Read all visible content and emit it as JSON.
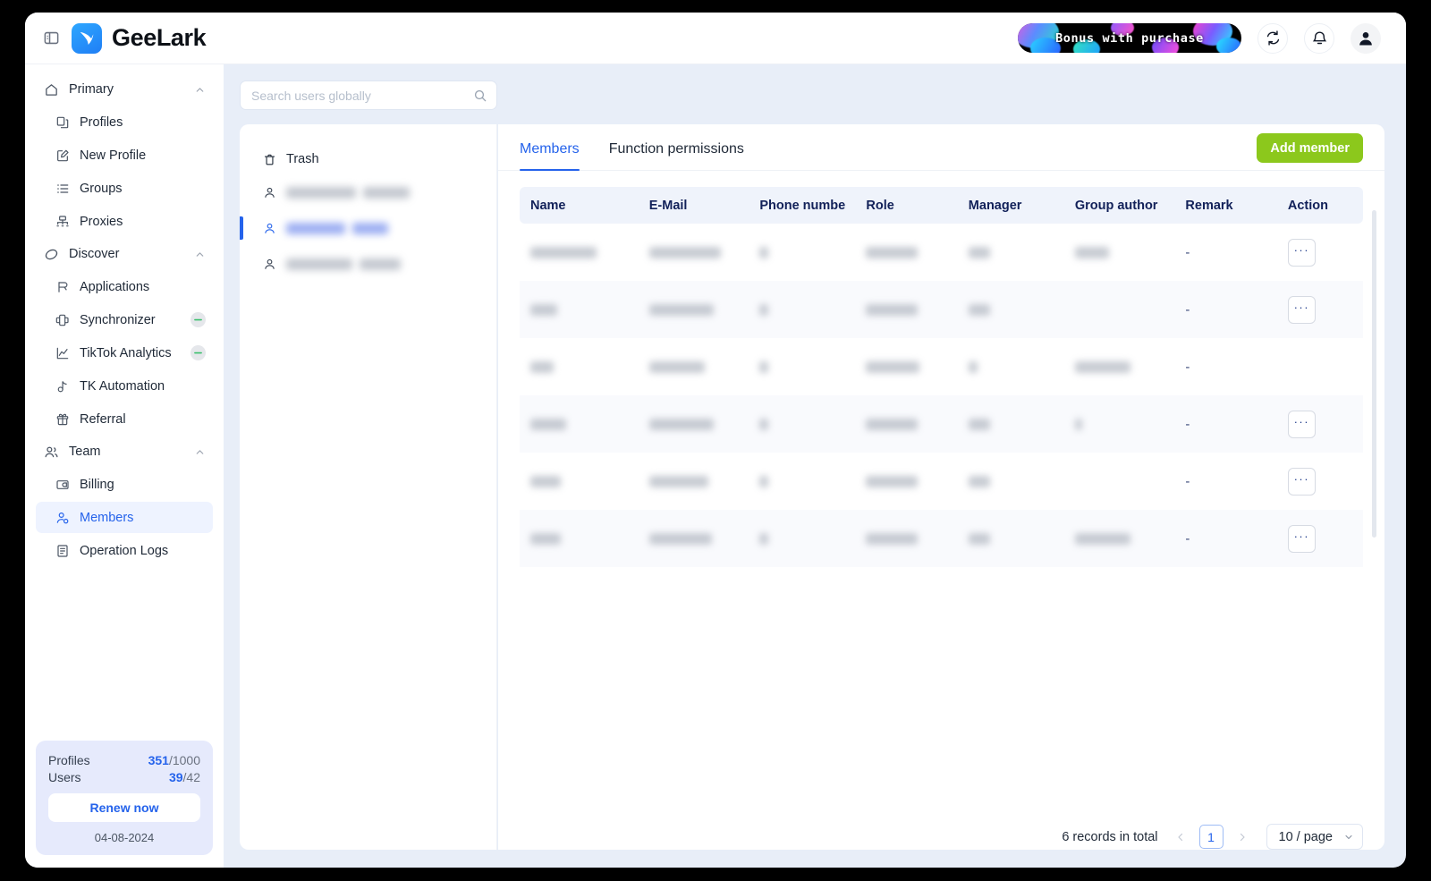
{
  "window": {
    "title": "GeeLark"
  },
  "topbar": {
    "panel_toggle_icon": "panel-left-icon",
    "brand_name": "GeeLark",
    "promo_text": "Bonus with purchase",
    "refresh_icon": "refresh-icon",
    "notification_icon": "bell-icon",
    "avatar_icon": "user-avatar-icon",
    "accent_green": "#8cc81c",
    "accent_blue": "#2563eb"
  },
  "sidebar": {
    "groups": [
      {
        "label": "Primary",
        "icon": "home-icon",
        "expanded": true,
        "items": [
          {
            "label": "Profiles",
            "icon": "profiles-icon"
          },
          {
            "label": "New Profile",
            "icon": "new-profile-icon"
          },
          {
            "label": "Groups",
            "icon": "groups-icon"
          },
          {
            "label": "Proxies",
            "icon": "proxies-icon"
          }
        ]
      },
      {
        "label": "Discover",
        "icon": "discover-icon",
        "expanded": true,
        "items": [
          {
            "label": "Applications",
            "icon": "applications-icon"
          },
          {
            "label": "Synchronizer",
            "icon": "synchronizer-icon",
            "badge": true
          },
          {
            "label": "TikTok Analytics",
            "icon": "analytics-icon",
            "badge": true
          },
          {
            "label": "TK Automation",
            "icon": "tiktok-note-icon"
          },
          {
            "label": "Referral",
            "icon": "gift-icon"
          }
        ]
      },
      {
        "label": "Team",
        "icon": "team-icon",
        "expanded": true,
        "items": [
          {
            "label": "Billing",
            "icon": "billing-icon"
          },
          {
            "label": "Members",
            "icon": "members-icon",
            "active": true
          },
          {
            "label": "Operation Logs",
            "icon": "logs-icon"
          }
        ]
      }
    ],
    "plan_card": {
      "profiles_label": "Profiles",
      "profiles_used": "351",
      "profiles_total": "/1000",
      "users_label": "Users",
      "users_used": "39",
      "users_total": "/42",
      "renew_label": "Renew now",
      "expiry_date": "04-08-2024"
    }
  },
  "search": {
    "placeholder": "Search users globally",
    "value": "",
    "icon": "search-icon"
  },
  "user_panel": {
    "trash_label": "Trash",
    "trash_icon": "trash-icon",
    "users": [
      {
        "icon": "user-icon",
        "redacted": true,
        "selected": false,
        "w1": 78,
        "w2": 52
      },
      {
        "icon": "user-icon",
        "redacted": true,
        "selected": true,
        "w1": 66,
        "w2": 40
      },
      {
        "icon": "user-icon",
        "redacted": true,
        "selected": false,
        "w1": 74,
        "w2": 46
      }
    ]
  },
  "main": {
    "tabs": [
      {
        "label": "Members",
        "active": true
      },
      {
        "label": "Function permissions",
        "active": false
      }
    ],
    "add_member_label": "Add member"
  },
  "table": {
    "columns": [
      "Name",
      "E-Mail",
      "Phone numbe",
      "Role",
      "Manager",
      "Group author",
      "Remark",
      "Action"
    ],
    "rows": [
      {
        "name_w": 74,
        "email_w": 80,
        "phone_w": 10,
        "role_w": 58,
        "manager_w": 24,
        "group_w": 38,
        "remark": "-",
        "action": "···"
      },
      {
        "name_w": 30,
        "email_w": 72,
        "phone_w": 10,
        "role_w": 58,
        "manager_w": 24,
        "group_w": 0,
        "remark": "-",
        "action": "···"
      },
      {
        "name_w": 26,
        "email_w": 62,
        "phone_w": 10,
        "role_w": 60,
        "manager_w": 10,
        "group_w": 62,
        "remark": "-",
        "action": ""
      },
      {
        "name_w": 40,
        "email_w": 72,
        "phone_w": 10,
        "role_w": 58,
        "manager_w": 24,
        "group_w": 8,
        "remark": "-",
        "action": "···"
      },
      {
        "name_w": 34,
        "email_w": 66,
        "phone_w": 10,
        "role_w": 58,
        "manager_w": 24,
        "group_w": 0,
        "remark": "-",
        "action": "···"
      },
      {
        "name_w": 34,
        "email_w": 70,
        "phone_w": 10,
        "role_w": 58,
        "manager_w": 24,
        "group_w": 62,
        "remark": "-",
        "action": "···"
      }
    ]
  },
  "pagination": {
    "records_total": "6 records in total",
    "prev_icon": "chevron-left-icon",
    "next_icon": "chevron-right-icon",
    "current_page": "1",
    "page_size": "10 / page",
    "page_size_chevron": "chevron-down-icon"
  }
}
